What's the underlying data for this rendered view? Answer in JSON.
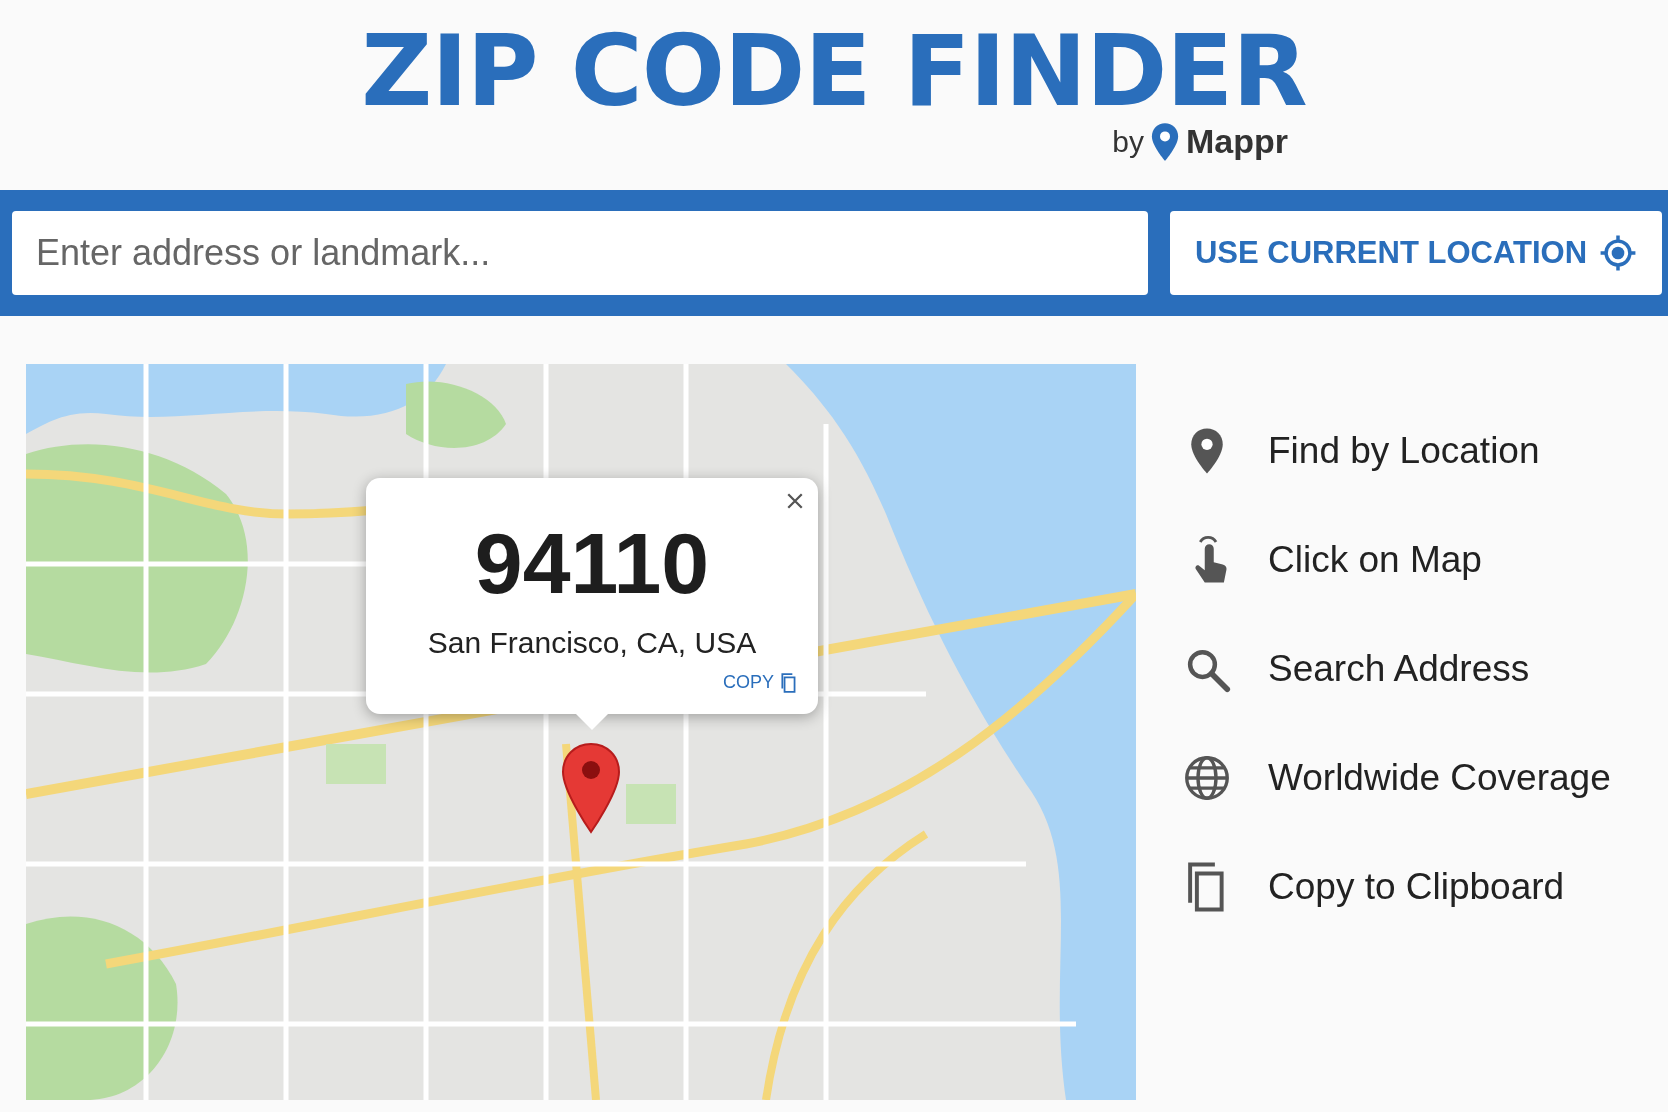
{
  "header": {
    "title": "ZIP CODE FINDER",
    "byline": "by",
    "brand": "Mappr"
  },
  "search": {
    "placeholder": "Enter address or landmark..."
  },
  "location_button": {
    "label": "USE CURRENT LOCATION"
  },
  "map": {
    "kind": "picture",
    "popup": {
      "zip": "94110",
      "place": "San Francisco, CA, USA",
      "copy": "COPY"
    }
  },
  "features": [
    {
      "kind": "pin",
      "label": "Find by Location"
    },
    {
      "kind": "tap",
      "label": "Click on Map"
    },
    {
      "kind": "search",
      "label": "Search Address"
    },
    {
      "kind": "globe",
      "label": "Worldwide Coverage"
    },
    {
      "kind": "copy",
      "label": "Copy to Clipboard"
    }
  ]
}
